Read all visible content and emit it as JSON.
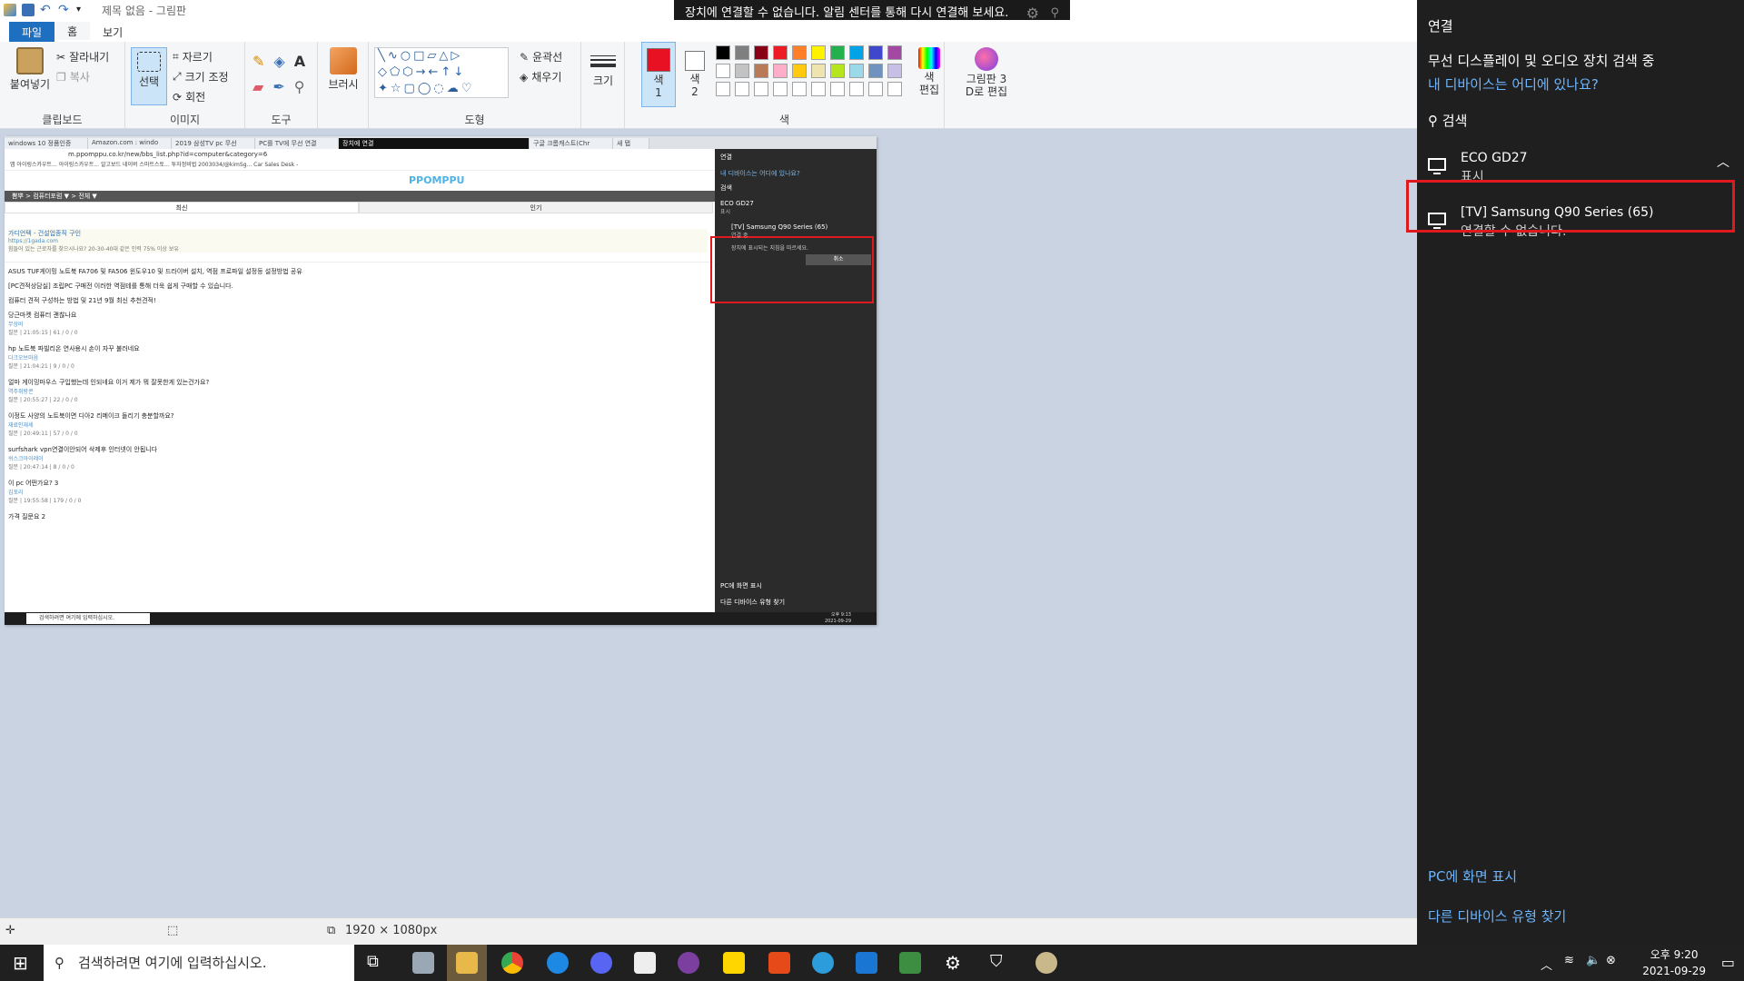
{
  "window": {
    "title": "제목 없음 - 그림판"
  },
  "ribbon": {
    "tabs": [
      "파일",
      "홈",
      "보기"
    ],
    "clipboard": {
      "label": "클립보드",
      "paste": "붙여넣기",
      "cut": "잘라내기",
      "copy": "복사"
    },
    "image": {
      "label": "이미지",
      "select": "선택",
      "crop": "자르기",
      "resize": "크기 조정",
      "rotate": "회전"
    },
    "tools": {
      "label": "도구"
    },
    "brushes": {
      "label": "브러시"
    },
    "shapes": {
      "label": "도형",
      "outline": "윤곽선",
      "fill": "채우기"
    },
    "size": {
      "label": "크기"
    },
    "colors": {
      "label": "색",
      "color1": "색\n1",
      "color2": "색\n2",
      "edit": "색\n편집",
      "color1_value": "#e81123",
      "color2_value": "#ffffff",
      "palette": [
        "#000000",
        "#7f7f7f",
        "#880015",
        "#ed1c24",
        "#ff7f27",
        "#fff200",
        "#22b14c",
        "#00a2e8",
        "#3f48cc",
        "#a349a4",
        "#ffffff",
        "#c3c3c3",
        "#b97a57",
        "#ffaec9",
        "#ffc90e",
        "#efe4b0",
        "#b5e61d",
        "#99d9ea",
        "#7092be",
        "#c8bfe7"
      ]
    },
    "paint3d": "그림판 3\nD로 편집"
  },
  "toast": {
    "text": "장치에 연결할 수 없습니다. 알림 센터를 통해 다시 연결해 보세요."
  },
  "canvas": {
    "browser_tabs": [
      "windows 10 정품인증",
      "Amazon.com : windo",
      "2019 삼성TV pc 무선",
      "PC를 TV에 무선 연결",
      "장치에 연결",
      "구글 크롬캐스트(Chr",
      "새 탭"
    ],
    "address": "m.ppomppu.co.kr/new/bbs_list.php?id=computer&category=6",
    "bookmarks": "앱  아이링스카우트...  아이링스카우트...  알고보드  네이버 스마트스토...  투자정비법  2003034/@kimSg...  Car Sales Desk -",
    "logo": "PPOMPPU",
    "crumb": "뽐뿌 > 컴퓨터포럼 ▼ > 전체 ▼",
    "subtabs": [
      "최신",
      "인기"
    ],
    "rows": [
      {
        "title": "가디언텍 - 건설업종직 구인",
        "sub": "https://1gada.com",
        "meta": "힘들어 있는 근로자를 찾으시나요? 20-30-40대 같은 인력 75% 이상 보유"
      },
      {
        "title": "ASUS TUF게이밍 노트북 FA706 및 FA506 윈도우10 및 드라이버 설치, 역점 프로파일 설정등 설정방법 공유",
        "sub": "",
        "meta": ""
      },
      {
        "title": "[PC견적상담실] 조립PC 구매전 이러한 역점테를 통해 더욱 쉽게 구매할 수 있습니다.",
        "sub": "",
        "meta": ""
      },
      {
        "title": "컴퓨터 견적 구성하는 방법 및 21년 9월 최신 추천견적!",
        "sub": "",
        "meta": ""
      },
      {
        "title": "당근마켓 컴퓨터 괜찮나요",
        "sub": "무상비",
        "meta": "질문 | 21:05:15 | 61 / 0 / 0"
      },
      {
        "title": "hp 노트북 파빌리온 연사용시 손이 자꾸 불러네요",
        "sub": "다크오브마음",
        "meta": "질문 | 21:04:21 | 9 / 0 / 0"
      },
      {
        "title": "얼마 게이밍마우스 구입했는데 인되네요 이거 제가 뭐 잘못한게 있는건가요?",
        "sub": "역주쥐랑콘",
        "meta": "질문 | 20:55:27 | 22 / 0 / 0"
      },
      {
        "title": "이정도 사양의 노트북이면 디아2 리메이크 돌리기 충분할까요?",
        "sub": "재료인재세",
        "meta": "질문 | 20:49:11 | 57 / 0 / 0"
      },
      {
        "title": "surfshark vpn연결이안되어 삭제후 인터넷이 안됩니다",
        "sub": "쉬스크아이레이",
        "meta": "질문 | 20:47:14 | 8 / 0 / 0"
      },
      {
        "title": "이 pc 어떤가요? 3",
        "sub": "김포리",
        "meta": "질문 | 19:55:58 | 179 / 0 / 0"
      },
      {
        "title": "가격 질문요 2",
        "sub": "",
        "meta": ""
      }
    ],
    "panel": {
      "title": "연결",
      "where": "내 디바이스는 어디에 있나요?",
      "search": "검색",
      "dev1": "ECO GD27",
      "dev1_status": "표시",
      "dev2": "[TV] Samsung Q90 Series (65)",
      "dev2_status": "연결 중",
      "instructions": "장치에 표시되는 지침을 따르세요.",
      "cancel": "취소",
      "project": "PC에 화면 표시",
      "other": "다른 디바이스 유형 찾기"
    },
    "taskbar_search": "검색하려면 여기에 입력하십시오.",
    "time": "오후 9:13",
    "date": "2021-09-29"
  },
  "statusbar": {
    "dimensions": "1920 × 1080px"
  },
  "panel": {
    "title": "연결",
    "searching": "무선 디스플레이 및 오디오 장치 검색 중",
    "where_link": "내 디바이스는 어디에 있나요?",
    "search": "검색",
    "devices": [
      {
        "name": "ECO GD27",
        "status": "표시"
      },
      {
        "name": "[TV] Samsung Q90 Series (65)",
        "status": "연결할 수 없습니다."
      }
    ],
    "project_link": "PC에 화면 표시",
    "other_link": "다른 디바이스 유형 찾기"
  },
  "taskbar": {
    "search_placeholder": "검색하려면 여기에 입력하십시오.",
    "time": "오후 9:20",
    "date": "2021-09-29"
  }
}
